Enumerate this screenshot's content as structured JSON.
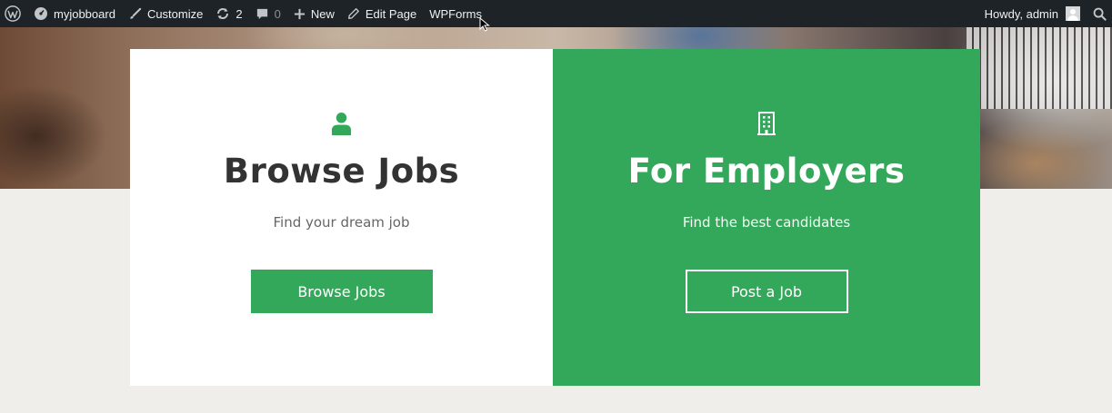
{
  "admin_bar": {
    "site_name": "myjobboard",
    "customize": "Customize",
    "updates_count": "2",
    "comments_count": "0",
    "new": "New",
    "edit_page": "Edit Page",
    "wpforms": "WPForms",
    "greeting": "Howdy, admin"
  },
  "cards": {
    "jobs": {
      "icon": "user-icon",
      "title": "Browse Jobs",
      "subtitle": "Find your dream job",
      "button": "Browse Jobs"
    },
    "employers": {
      "icon": "building-icon",
      "title": "For Employers",
      "subtitle": "Find the best candidates",
      "button": "Post a Job"
    }
  },
  "colors": {
    "admin_bar_bg": "#1d2327",
    "brand_green": "#34a85a",
    "page_bg": "#efeeea",
    "title_dark": "#333333"
  }
}
